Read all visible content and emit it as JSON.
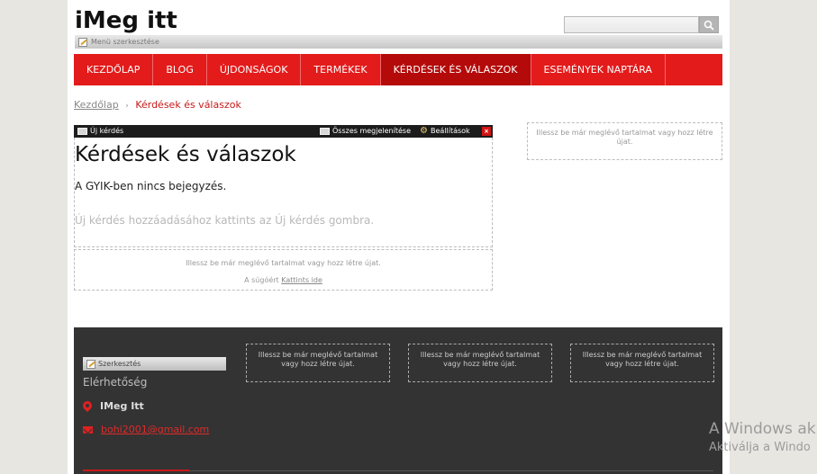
{
  "site": {
    "title": "iMeg itt",
    "menu_edit_label": "Menü szerkesztése",
    "search_placeholder": "",
    "search_icon": "magnifier-icon"
  },
  "nav": {
    "items": [
      {
        "label": "KEZDŐLAP"
      },
      {
        "label": "BLOG"
      },
      {
        "label": "ÚJDONSÁGOK"
      },
      {
        "label": "TERMÉKEK"
      },
      {
        "label": "KÉRDÉSEK ÉS VÁLASZOK"
      },
      {
        "label": "ESEMÉNYEK NAPTÁRA"
      }
    ],
    "active_index": 4
  },
  "breadcrumb": {
    "home": "Kezdőlap",
    "separator": "›",
    "current": "Kérdések és válaszok"
  },
  "toolbar": {
    "new_question": "Új kérdés",
    "show_all": "Összes megjelenítése",
    "settings": "Beállítások",
    "close": "×"
  },
  "faq": {
    "title": "Kérdések és válaszok",
    "empty_text": "A GYIK-ben nincs bejegyzés.",
    "hint_text": "Új kérdés hozzáadásához kattints az Új kérdés gombra."
  },
  "placeholders": {
    "insert_content": "Illessz be már meglévő tartalmat vagy hozz létre újat.",
    "help_prefix": "A súgóért",
    "help_link": "Kattints ide"
  },
  "footer": {
    "edit_label": "Szerkesztés",
    "heading": "Elérhetőség",
    "site_name": "IMeg Itt",
    "email": "bohi2001@gmail.com",
    "drop_line1": "Illessz be már meglévő tartalmat",
    "drop_line2": "vagy hozz létre újat."
  },
  "watermark": {
    "line1": "A Windows ak",
    "line2": "Aktiválja a Windo"
  },
  "colors": {
    "accent": "#e31b1b",
    "accent_active": "#b40a0a",
    "footer_bg": "#333333",
    "page_bg": "#e8e6e1"
  }
}
